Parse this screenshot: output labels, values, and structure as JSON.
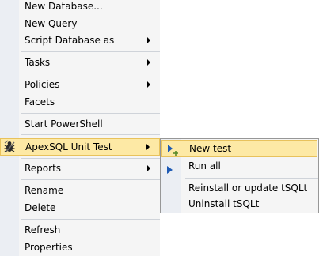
{
  "context_menu": {
    "items": [
      {
        "label": "New Database...",
        "has_submenu": false
      },
      {
        "label": "New Query",
        "has_submenu": false
      },
      {
        "label": "Script Database as",
        "has_submenu": true
      },
      {
        "label": "Tasks",
        "has_submenu": true
      },
      {
        "label": "Policies",
        "has_submenu": true
      },
      {
        "label": "Facets",
        "has_submenu": false
      },
      {
        "label": "Start PowerShell",
        "has_submenu": false
      },
      {
        "label": "ApexSQL Unit Test",
        "has_submenu": true,
        "highlighted": true,
        "icon": "apexsql-unit-test-icon"
      },
      {
        "label": "Reports",
        "has_submenu": true
      },
      {
        "label": "Rename",
        "has_submenu": false
      },
      {
        "label": "Delete",
        "has_submenu": false
      },
      {
        "label": "Refresh",
        "has_submenu": false
      },
      {
        "label": "Properties",
        "has_submenu": false
      }
    ]
  },
  "submenu": {
    "items": [
      {
        "label": "New test",
        "highlighted": true,
        "icon": "new-test-icon"
      },
      {
        "label": "Run all",
        "icon": "run-all-icon"
      },
      {
        "label": "Reinstall or update tSQLt"
      },
      {
        "label": "Uninstall tSQLt"
      }
    ]
  },
  "colors": {
    "menu_background": "#f5f5f5",
    "gutter": "#ebeef3",
    "highlight": "#fde9a5",
    "highlight_border": "#e8c25c",
    "separator": "#cfd3d9",
    "run_icon": "#1e5ab4"
  }
}
